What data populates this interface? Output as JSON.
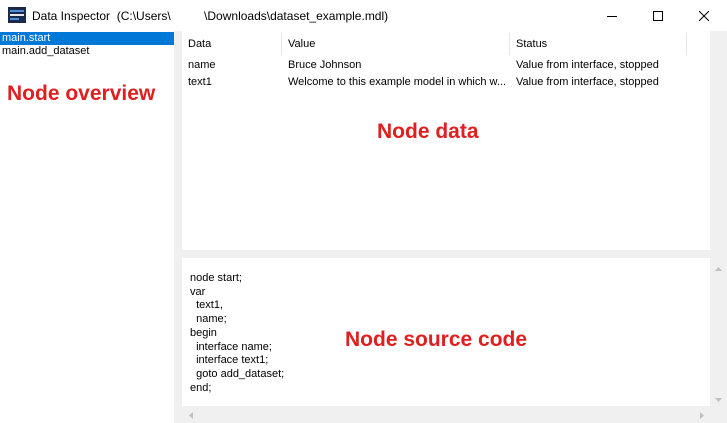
{
  "window": {
    "title": "Data Inspector  (C:\\Users\\          \\Downloads\\dataset_example.mdl)",
    "app_icon": "app-icon",
    "controls": [
      "minimize-icon",
      "maximize-icon",
      "close-icon"
    ]
  },
  "node_overview": {
    "items": [
      {
        "label": "main.start",
        "selected": true
      },
      {
        "label": "main.add_dataset",
        "selected": false
      }
    ]
  },
  "node_data": {
    "columns": [
      "Data",
      "Value",
      "Status"
    ],
    "rows": [
      {
        "data": "name",
        "value": "Bruce Johnson",
        "status": "Value from interface, stopped"
      },
      {
        "data": "text1",
        "value": "Welcome to this example model in which w...",
        "status": "Value from interface, stopped"
      }
    ]
  },
  "source": {
    "lines": [
      "node start;",
      "var",
      "  text1,",
      "  name;",
      "begin",
      "  interface name;",
      "  interface text1;",
      "  goto add_dataset;",
      "end;"
    ]
  },
  "annotations": {
    "overview": "Node overview",
    "data": "Node data",
    "source": "Node source code",
    "color": "#e02020"
  },
  "colors": {
    "selection": "#0078d7",
    "panel_bg": "#f0f0f0"
  }
}
